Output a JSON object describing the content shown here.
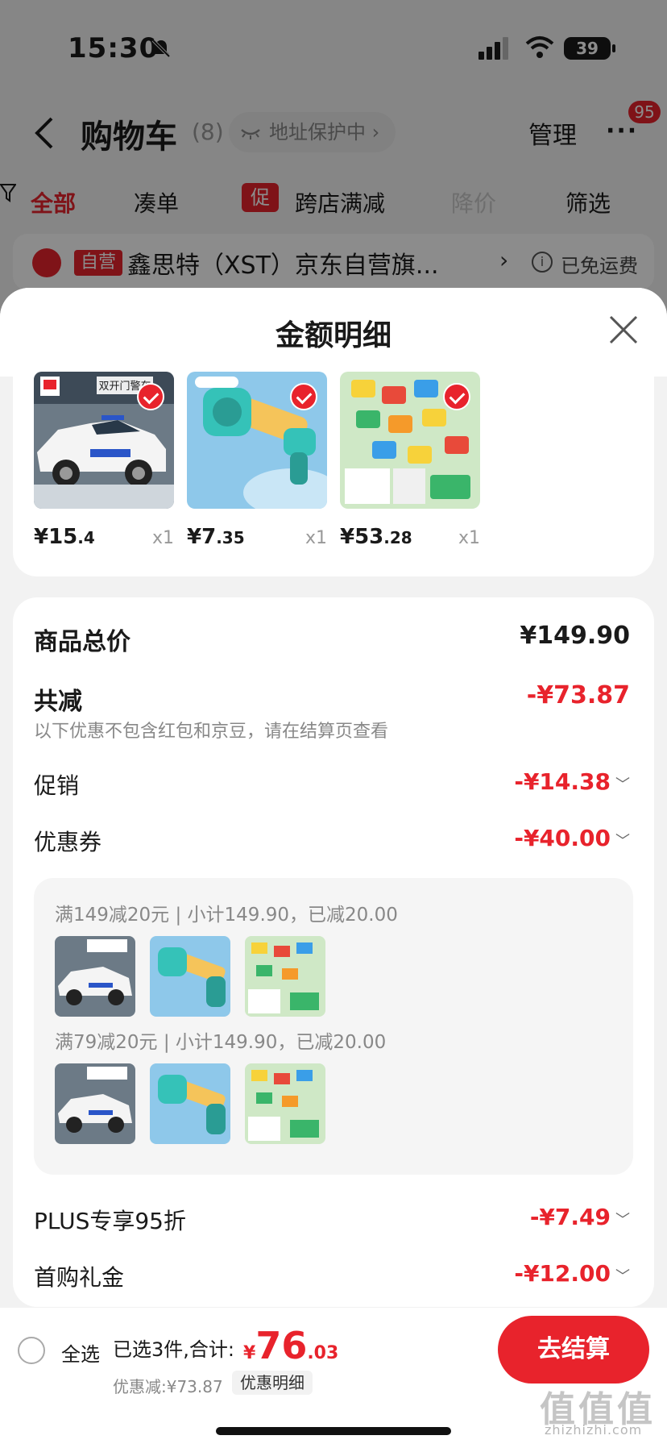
{
  "status": {
    "time": "15:30",
    "battery": "39"
  },
  "nav": {
    "title": "购物车",
    "count": "(8)",
    "address_protect": "地址保护中 ›",
    "manage": "管理",
    "more": "···",
    "badge": "95"
  },
  "filters": {
    "all": "全部",
    "bundle": "凑单",
    "promo_tag": "促",
    "cross_store": "跨店满减",
    "price_drop": "降价",
    "screen": "筛选"
  },
  "store": {
    "tag": "自营",
    "name": "鑫思特（XST）京东自营旗...",
    "arrow": "›",
    "info": "i",
    "shipping": "已免运费"
  },
  "sheet": {
    "title": "金额明细"
  },
  "products": [
    {
      "price_int": "¥15",
      "price_dec": ".4",
      "qty": "x1",
      "image": "police-pickup-truck-toy",
      "box_text": "双开门警车"
    },
    {
      "price_int": "¥7",
      "price_dec": ".35",
      "qty": "x1",
      "image": "water-gun-toy"
    },
    {
      "price_int": "¥53",
      "price_dec": ".28",
      "qty": "x1",
      "image": "toy-cars-set"
    }
  ],
  "detail": {
    "total_label": "商品总价",
    "total_value": "¥149.90",
    "reduce_label": "共减",
    "reduce_value": "-¥73.87",
    "hint": "以下优惠不包含红包和京豆，请在结算页查看",
    "promo_label": "促销",
    "promo_value": "-¥14.38",
    "coupon_label": "优惠券",
    "coupon_value": "-¥40.00",
    "coupon_lines": [
      "满149减20元 | 小计149.90，已减20.00",
      "满79减20元 | 小计149.90，已减20.00"
    ],
    "plus_label": "PLUS专享95折",
    "plus_value": "-¥7.49",
    "gift_label": "首购礼金",
    "gift_value": "-¥12.00"
  },
  "bottom": {
    "select_all": "全选",
    "selected_text": "已选3件,合计:",
    "total_currency": "¥",
    "total_int": "76",
    "total_dec": ".03",
    "discount_text": "优惠减:¥73.87",
    "detail_btn": "优惠明细",
    "checkout": "去结算"
  },
  "watermark": {
    "text": "值值值",
    "sub": "zhizhizhi.com"
  },
  "colors": {
    "accent": "#e8232c",
    "sheet_bg": "#f2f2f2"
  }
}
